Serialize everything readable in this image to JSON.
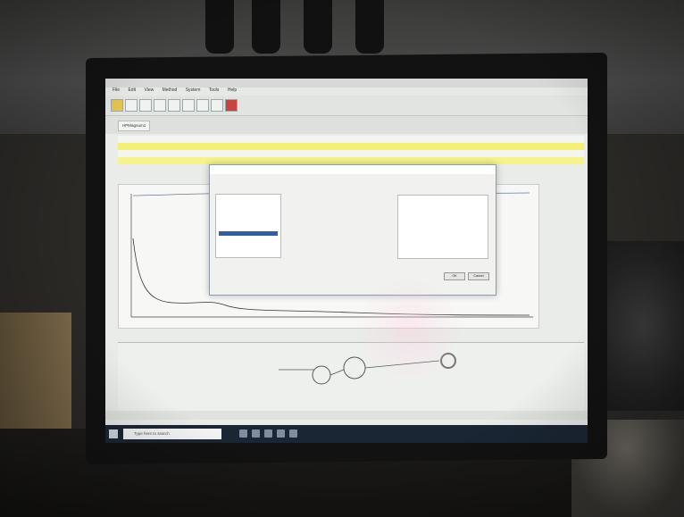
{
  "app": {
    "menu": [
      "File",
      "Edit",
      "View",
      "Method",
      "System",
      "Tools",
      "Help"
    ]
  },
  "tabs": [
    {
      "label": "HPMagnum1"
    }
  ],
  "dialog": {
    "buttons": [
      "OK",
      "Cancel"
    ]
  },
  "taskbar": {
    "search_placeholder": "Type here to search"
  },
  "colors": {
    "screen_bg": "#e9ece8",
    "highlight_row": "#f3f073",
    "selected_tree": "#2f5fa8",
    "taskbar": "#1b2634"
  },
  "icons": [
    "windows-start-icon",
    "search-icon",
    "folder-icon",
    "monitor-icon",
    "document-icon",
    "settings-icon"
  ]
}
